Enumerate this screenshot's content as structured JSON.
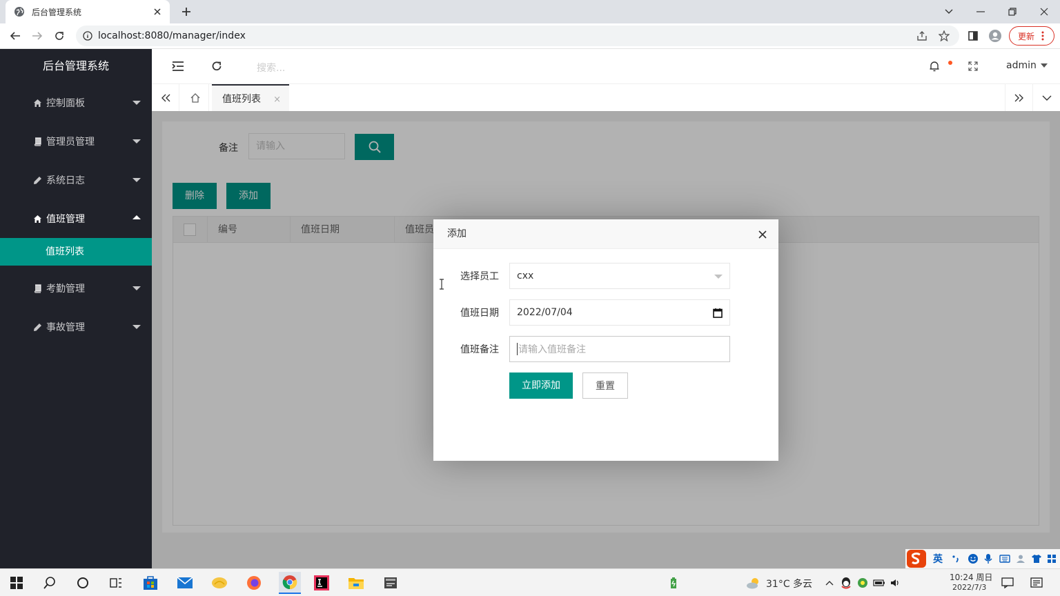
{
  "browser": {
    "tab_title": "后台管理系统",
    "url": "localhost:8080/manager/index",
    "update_label": "更新"
  },
  "sidebar": {
    "brand": "后台管理系统",
    "items": [
      {
        "label": "控制面板",
        "icon": "home-icon"
      },
      {
        "label": "管理员管理",
        "icon": "book-icon"
      },
      {
        "label": "系统日志",
        "icon": "pencil-icon"
      },
      {
        "label": "值班管理",
        "icon": "home-icon"
      },
      {
        "label": "考勤管理",
        "icon": "book-icon"
      },
      {
        "label": "事故管理",
        "icon": "pencil-icon"
      }
    ],
    "active_sub": "值班列表"
  },
  "header": {
    "search_placeholder": "搜索...",
    "user": "admin"
  },
  "tabs": {
    "current": "值班列表",
    "close": "×"
  },
  "filter": {
    "label": "备注",
    "placeholder": "请输入"
  },
  "actions": {
    "delete": "删除",
    "add": "添加"
  },
  "table": {
    "columns": [
      "编号",
      "值班日期",
      "值班员"
    ]
  },
  "modal": {
    "title": "添加",
    "employee_label": "选择员工",
    "employee_value": "cxx",
    "date_label": "值班日期",
    "date_value": "2022/07/04",
    "note_label": "值班备注",
    "note_placeholder": "请输入值班备注",
    "submit": "立即添加",
    "reset": "重置"
  },
  "taskbar": {
    "weather": "31°C 多云",
    "time": "10:24 周日",
    "date": "2022/7/3",
    "ime_lang": "英"
  },
  "colors": {
    "accent": "#009688",
    "sidebar_bg": "#20222a",
    "notify": "#ff5722"
  }
}
